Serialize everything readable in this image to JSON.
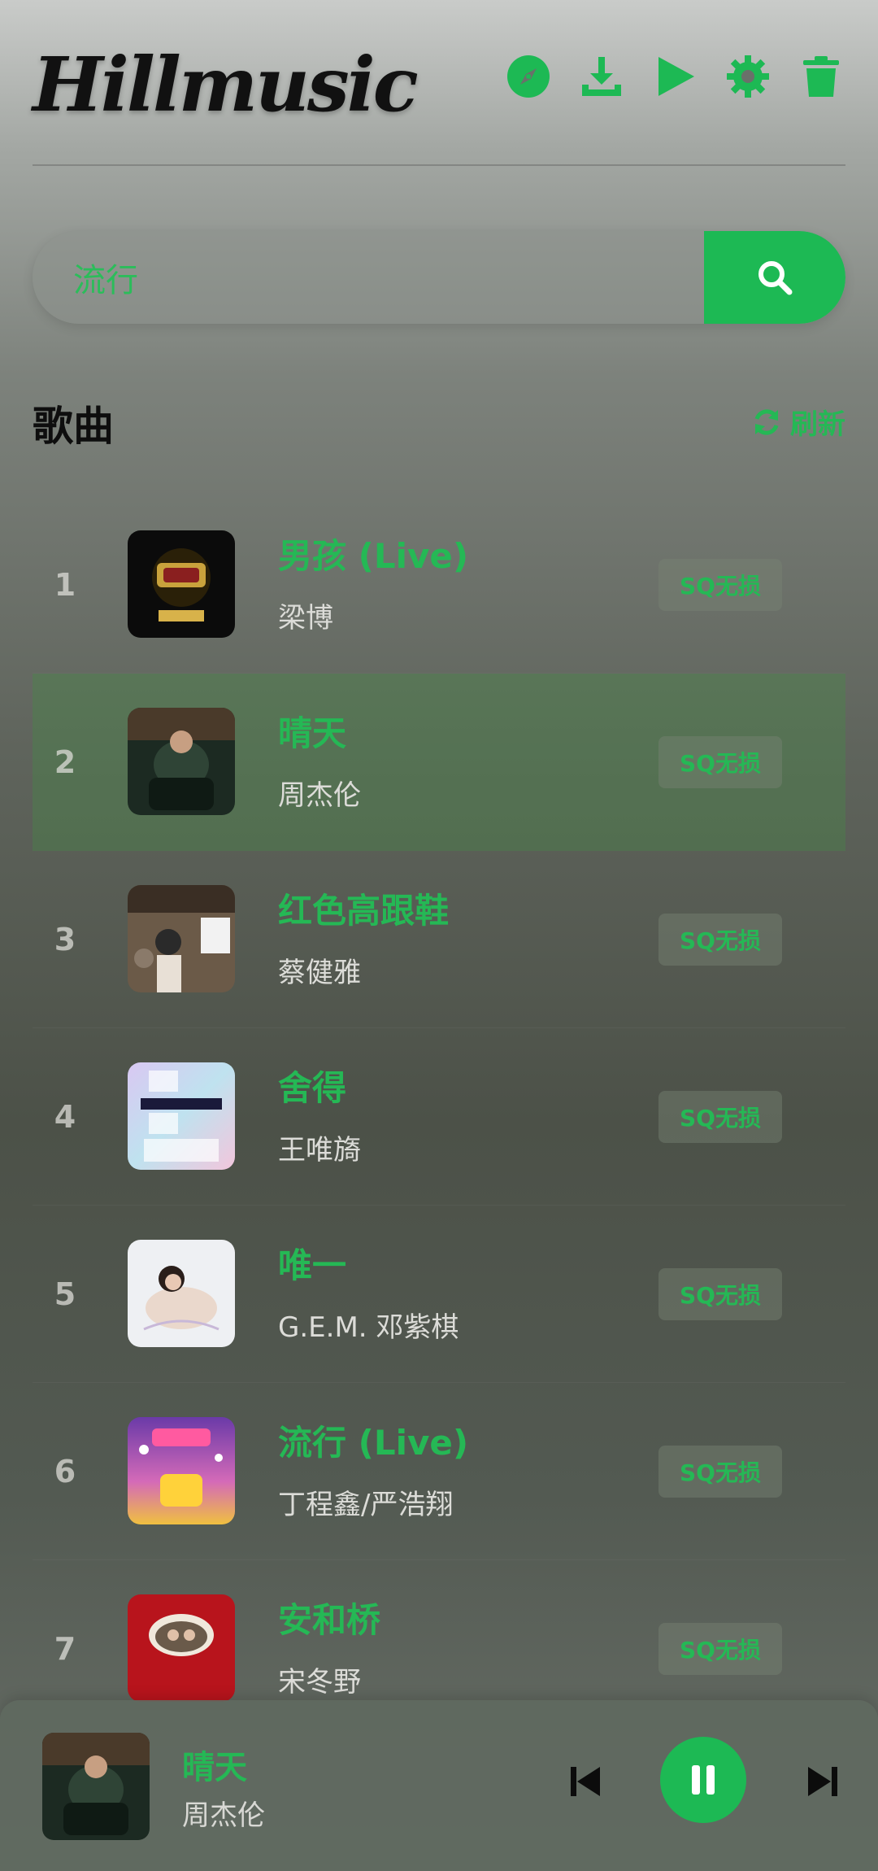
{
  "app": {
    "title": "Hillmusic"
  },
  "toolbar": [
    {
      "name": "discover-icon"
    },
    {
      "name": "download-icon"
    },
    {
      "name": "play-icon"
    },
    {
      "name": "gear-icon"
    },
    {
      "name": "trash-icon"
    }
  ],
  "search": {
    "value": "流行",
    "placeholder": ""
  },
  "section": {
    "title": "歌曲",
    "refresh_label": "刷新"
  },
  "songs": [
    {
      "num": "1",
      "title": "男孩 (Live)",
      "artist": "梁博",
      "quality": "SQ无损",
      "active": false
    },
    {
      "num": "2",
      "title": "晴天",
      "artist": "周杰伦",
      "quality": "SQ无损",
      "active": true
    },
    {
      "num": "3",
      "title": "红色高跟鞋",
      "artist": "蔡健雅",
      "quality": "SQ无损",
      "active": false
    },
    {
      "num": "4",
      "title": "舍得",
      "artist": "王唯旖",
      "quality": "SQ无损",
      "active": false
    },
    {
      "num": "5",
      "title": "唯一",
      "artist": "G.E.M. 邓紫棋",
      "quality": "SQ无损",
      "active": false
    },
    {
      "num": "6",
      "title": "流行 (Live)",
      "artist": "丁程鑫/严浩翔",
      "quality": "SQ无损",
      "active": false
    },
    {
      "num": "7",
      "title": "安和桥",
      "artist": "宋冬野",
      "quality": "SQ无损",
      "active": false
    }
  ],
  "player": {
    "title": "晴天",
    "artist": "周杰伦",
    "state": "playing"
  },
  "colors": {
    "accent": "#1db954",
    "accent_text": "#25b855"
  }
}
